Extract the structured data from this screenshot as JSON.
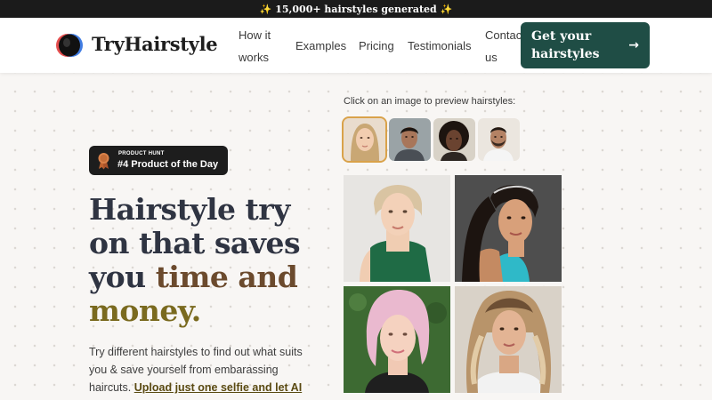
{
  "announcement": "✨ 15,000+ hairstyles generated ✨",
  "brand": {
    "name": "TryHairstyle"
  },
  "nav": {
    "items": [
      "How it works",
      "Examples",
      "Pricing",
      "Testimonials",
      "Contact us"
    ],
    "cta": "Get your hairstyles",
    "cta_icon": "arrow-right-icon"
  },
  "badge": {
    "eyebrow": "PRODUCT HUNT",
    "title": "#4 Product of the Day",
    "icon": "medal-icon"
  },
  "hero": {
    "headline_plain": "Hairstyle try on that saves you",
    "headline_accent1": "time and",
    "headline_accent2": "money.",
    "body": "Try different hairstyles to find out what suits you & save yourself from embarassing haircuts.",
    "body_link": "Upload just one selfie and let AI do the rest."
  },
  "preview": {
    "label": "Click on an image to preview hairstyles:",
    "thumbnails": [
      "blonde-woman",
      "man-dark-hair",
      "woman-curly-hair",
      "man-beard"
    ],
    "selected_index": 0,
    "photos": [
      "blonde-ponytail-green-turtleneck",
      "dark-sleek-ponytail-teal-top",
      "pink-bob-cut",
      "wavy-balayage-hair"
    ]
  },
  "colors": {
    "announcement_bg": "#1b1b1b",
    "cta_bg": "#1f4d45",
    "headline": "#2f3442",
    "accent_brown": "#6b4a2d",
    "accent_olive": "#7a6a1f",
    "thumb_outline": "#d9a24a"
  }
}
